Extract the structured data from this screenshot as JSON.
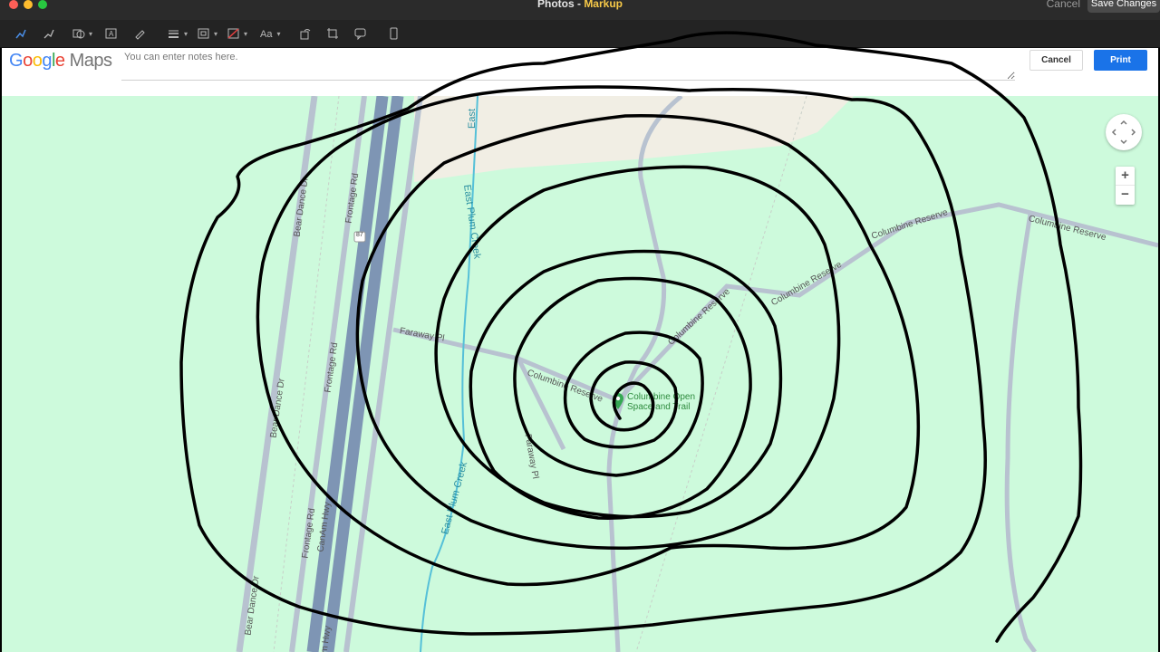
{
  "window": {
    "title_prefix": "Photos - ",
    "title_accent": "Markup",
    "cancel_label": "Cancel",
    "save_label": "Save Changes"
  },
  "toolbar": {
    "tools": [
      "sketch",
      "draw",
      "shapes",
      "text",
      "highlight",
      "shape-style",
      "border-color",
      "fill-color",
      "text-style",
      "rotate",
      "crop",
      "annotate",
      "description"
    ],
    "text_style_label": "Aa"
  },
  "print_header": {
    "logo_google": "Google",
    "logo_maps": "Maps",
    "notes_placeholder": "You can enter notes here.",
    "cancel_label": "Cancel",
    "print_label": "Print"
  },
  "map": {
    "road_labels": {
      "bear_dance_1": "Bear Dance Dr",
      "bear_dance_2": "Bear Dance Dr",
      "bear_dance_3": "Bear Dance Dr",
      "frontage_1": "Frontage Rd",
      "frontage_2": "Frontage Rd",
      "frontage_3": "Frontage Rd",
      "canam_1": "CanAm Hwy",
      "canam_2": "m Hwy",
      "route": "87",
      "faraway_1": "Faraway Pl",
      "faraway_2": "Faraway Pl",
      "columbine_1": "Columbine Reserve",
      "columbine_2": "Columbine Reserve",
      "columbine_3": "Columbine Reserve",
      "columbine_4": "Columbine Reserve",
      "columbine_5": "Columbine Reserve"
    },
    "water_labels": {
      "east_top": "East",
      "plum_creek_1": "East Plum Creek",
      "plum_creek_2": "East Plum Creek"
    },
    "poi": {
      "line1": "Columbine Open",
      "line2": "Space and Trail"
    },
    "zoom_in": "+",
    "zoom_out": "−"
  },
  "colors": {
    "map_green": "#cdfadc",
    "highway": "#7e95b4",
    "road": "#b8c2d0",
    "creek": "#55c0d8",
    "print_blue": "#1a73e8"
  }
}
